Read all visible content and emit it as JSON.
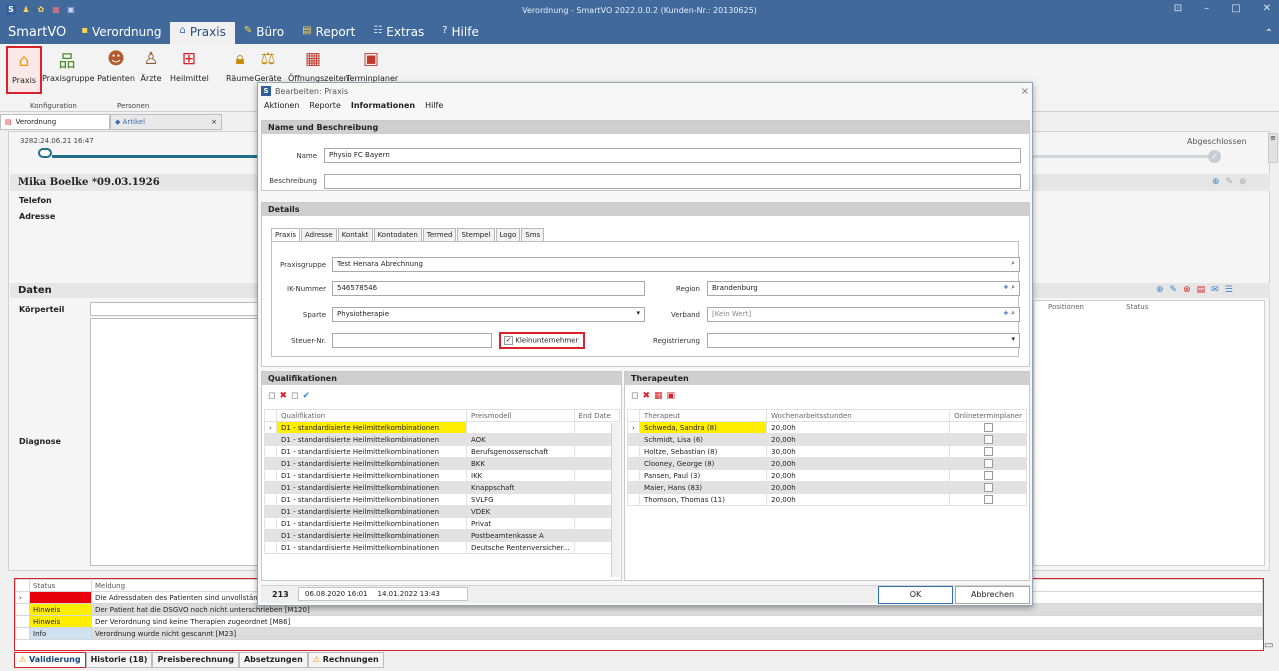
{
  "titlebar": {
    "title": "Verordnung - SmartVO 2022.0.0.2 (Kunden-Nr.: 20130625)",
    "win_min": "–",
    "win_max": "□",
    "win_close": "✕",
    "win_extra": "⊡"
  },
  "menubar": {
    "brand": "SmartVO",
    "items": [
      {
        "label": "Verordnung"
      },
      {
        "label": "Praxis"
      },
      {
        "label": "Büro"
      },
      {
        "label": "Report"
      },
      {
        "label": "Extras"
      },
      {
        "label": "Hilfe"
      }
    ]
  },
  "ribbon": {
    "buttons": [
      {
        "label": "Praxis"
      },
      {
        "label": "Praxisgruppe"
      },
      {
        "label": "Patienten"
      },
      {
        "label": "Ärzte"
      },
      {
        "label": "Heilmittel"
      },
      {
        "label": "Räume"
      },
      {
        "label": "Geräte"
      },
      {
        "label": "Öffnungszeiten"
      },
      {
        "label": "Terminplaner"
      }
    ],
    "groups": [
      "Konfiguration",
      "Personen"
    ]
  },
  "doc_tabs": [
    {
      "label": "Verordnung"
    },
    {
      "label": "Artikel"
    }
  ],
  "left": {
    "vo_id": "3282:24.06.21 16:47",
    "patient": "Mika Boelke  *09.03.1926",
    "telefon": "Telefon",
    "adresse": "Adresse",
    "daten": "Daten",
    "koerperteil": "Körperteil",
    "diagnose": "Diagnose"
  },
  "right": {
    "status_label": "Abgeschlossen",
    "positionen": "Positionen",
    "status": "Status"
  },
  "dialog": {
    "title": "Bearbeiten: Praxis",
    "menu": [
      "Aktionen",
      "Reporte",
      "Informationen",
      "Hilfe"
    ],
    "sec_name": "Name und Beschreibung",
    "name_label": "Name",
    "name_value": "Physio FC Bayern",
    "beschreibung_label": "Beschreibung",
    "beschreibung_value": "",
    "sec_details": "Details",
    "tabs": [
      "Praxis",
      "Adresse",
      "Kontakt",
      "Kontodaten",
      "Termed",
      "Stempel",
      "Logo",
      "Sms"
    ],
    "praxisgruppe_label": "Praxisgruppe",
    "praxisgruppe_value": "Test Henara Abrechnung",
    "ik_label": "IK-Nummer",
    "ik_value": "546578546",
    "region_label": "Region",
    "region_value": "Brandenburg",
    "sparte_label": "Sparte",
    "sparte_value": "Physiotherapie",
    "verband_label": "Verband",
    "verband_value": "[Kein Wert]",
    "steuer_label": "Steuer-Nr.",
    "steuer_value": "",
    "klein_label": "Kleinunternehmer",
    "klein_checked": true,
    "registrierung_label": "Registrierung",
    "registrierung_value": "",
    "sec_qual": "Qualifikationen",
    "qual_cols": [
      "Qualifikation",
      "Preismodell",
      "End Date"
    ],
    "qual_rows": [
      [
        "D1 - standardisierte Heilmittelkombinationen",
        ""
      ],
      [
        "D1 - standardisierte Heilmittelkombinationen",
        "AOK"
      ],
      [
        "D1 - standardisierte Heilmittelkombinationen",
        "Berufsgenossenschaft"
      ],
      [
        "D1 - standardisierte Heilmittelkombinationen",
        "BKK"
      ],
      [
        "D1 - standardisierte Heilmittelkombinationen",
        "IKK"
      ],
      [
        "D1 - standardisierte Heilmittelkombinationen",
        "Knappschaft"
      ],
      [
        "D1 - standardisierte Heilmittelkombinationen",
        "SVLFG"
      ],
      [
        "D1 - standardisierte Heilmittelkombinationen",
        "VDEK"
      ],
      [
        "D1 - standardisierte Heilmittelkombinationen",
        "Privat"
      ],
      [
        "D1 - standardisierte Heilmittelkombinationen",
        "Postbeamtenkasse A"
      ],
      [
        "D1 - standardisierte Heilmittelkombinationen",
        "Deutsche Rentenversicher..."
      ]
    ],
    "sec_ther": "Therapeuten",
    "ther_cols": [
      "Therapeut",
      "Wochenarbeitsstunden",
      "Onlineterminplaner"
    ],
    "ther_rows": [
      [
        "Schweda, Sandra (8)",
        "20,00h"
      ],
      [
        "Schmidt, Lisa (6)",
        "20,00h"
      ],
      [
        "Holtze, Sebastian (8)",
        "30,00h"
      ],
      [
        "Clooney, George (8)",
        "20,00h"
      ],
      [
        "Pansen, Paul (3)",
        "20,00h"
      ],
      [
        "Maier, Hans (83)",
        "20,00h"
      ],
      [
        "Thomson, Thomas (11)",
        "20,00h"
      ]
    ],
    "footer_id": "213",
    "footer_created": "06.08.2020 16:01",
    "footer_modified": "14.01.2022 13:43",
    "ok": "OK",
    "cancel": "Abbrechen"
  },
  "validation": {
    "cols": [
      "Status",
      "Meldung"
    ],
    "rows": [
      {
        "status": "",
        "msg": "Die Adressdaten des Patienten sind unvollständig"
      },
      {
        "status": "Hinweis",
        "msg": "Der Patient hat die DSGVO noch nicht unterschrieben [M120]"
      },
      {
        "status": "Hinweis",
        "msg": "Der Verordnung sind keine Therapien zugeordnet [M86]"
      },
      {
        "status": "Info",
        "msg": "Verordnung wurde nicht gescannt [M23]"
      }
    ]
  },
  "bottom_tabs": [
    "Validierung",
    "Historie (18)",
    "Preisberechnung",
    "Absetzungen",
    "Rechnungen"
  ],
  "colors": {
    "titlebar": "#41699c",
    "accent": "#d8232a",
    "highlight": "#ffee00"
  }
}
